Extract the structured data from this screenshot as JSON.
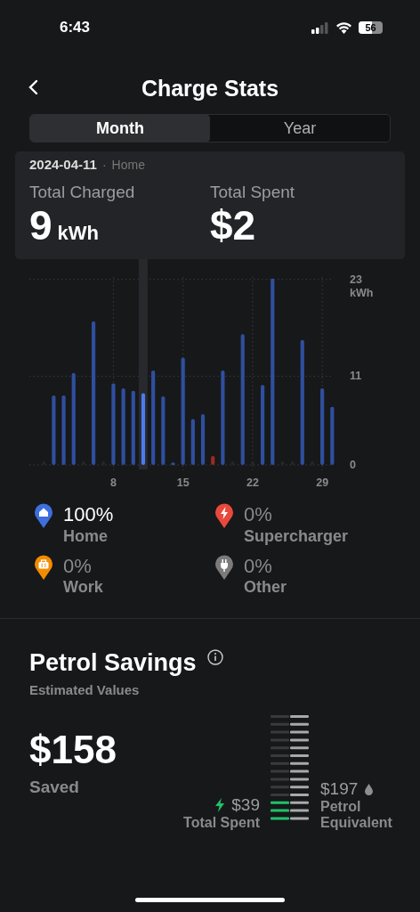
{
  "status_bar": {
    "time": "6:43",
    "battery": "56"
  },
  "header": {
    "title": "Charge Stats"
  },
  "tabs": [
    {
      "label": "Month",
      "selected": true
    },
    {
      "label": "Year",
      "selected": false
    }
  ],
  "tooltip": {
    "date": "2024-04-11",
    "separator": "·",
    "location": "Home",
    "stats": [
      {
        "label": "Total Charged",
        "value": "9",
        "unit": "kWh"
      },
      {
        "label": "Total Spent",
        "value": "$2"
      }
    ]
  },
  "chart": {
    "chart_data": {
      "type": "bar",
      "grid": true,
      "x": [
        1,
        2,
        3,
        4,
        5,
        6,
        7,
        8,
        9,
        10,
        11,
        12,
        13,
        14,
        15,
        16,
        17,
        18,
        19,
        20,
        21,
        22,
        23,
        24,
        25,
        26,
        27,
        28,
        29,
        30
      ],
      "xlim": [
        -0.45,
        30.15
      ],
      "ylabel": "kWh",
      "ylim": [
        0,
        23.3
      ],
      "yticks": [
        0,
        11,
        23
      ],
      "xticks": [
        8,
        15,
        22,
        29
      ],
      "series": [
        {
          "color": "#2f4f9e",
          "values": [
            0,
            8.6,
            8.6,
            11.4,
            0,
            17.8,
            0,
            10.1,
            9.5,
            9.2,
            null,
            11.7,
            8.5,
            0.3,
            13.3,
            5.7,
            6.3,
            null,
            11.7,
            0,
            16.2,
            0,
            9.9,
            23.1,
            0,
            0,
            15.5,
            0,
            9.5,
            7.2
          ]
        },
        {
          "color": "#4a7cf0",
          "values": [
            null,
            null,
            null,
            null,
            null,
            null,
            null,
            null,
            null,
            null,
            8.9,
            null,
            null,
            null,
            null,
            null,
            null,
            null,
            null,
            null,
            null,
            null,
            null,
            null,
            null,
            null,
            null,
            null,
            null,
            null
          ]
        },
        {
          "color": "#9a2a22",
          "values": [
            null,
            null,
            null,
            null,
            null,
            null,
            null,
            null,
            null,
            null,
            null,
            null,
            null,
            null,
            null,
            null,
            null,
            1.1,
            null,
            null,
            null,
            null,
            null,
            null,
            null,
            null,
            null,
            null,
            null,
            null
          ]
        }
      ]
    }
  },
  "legend": [
    {
      "kind": "home",
      "percent": "100%",
      "label": "Home",
      "color": "#3d6fdd",
      "active": true
    },
    {
      "kind": "bolt",
      "percent": "0%",
      "label": "Supercharger",
      "color": "#e8493c",
      "active": false
    },
    {
      "kind": "work",
      "percent": "0%",
      "label": "Work",
      "color": "#f28c00",
      "active": false
    },
    {
      "kind": "plug",
      "percent": "0%",
      "label": "Other",
      "color": "#7b7b7b",
      "active": false
    }
  ],
  "savings": {
    "title": "Petrol Savings",
    "subtitle": "Estimated Values",
    "amount": "$158",
    "amount_label": "Saved",
    "spent": "$39",
    "spent_label": "Total Spent",
    "petrol": "$197",
    "petrol_label": "Petrol Equivalent",
    "gauge": {
      "level": 0.2
    }
  }
}
